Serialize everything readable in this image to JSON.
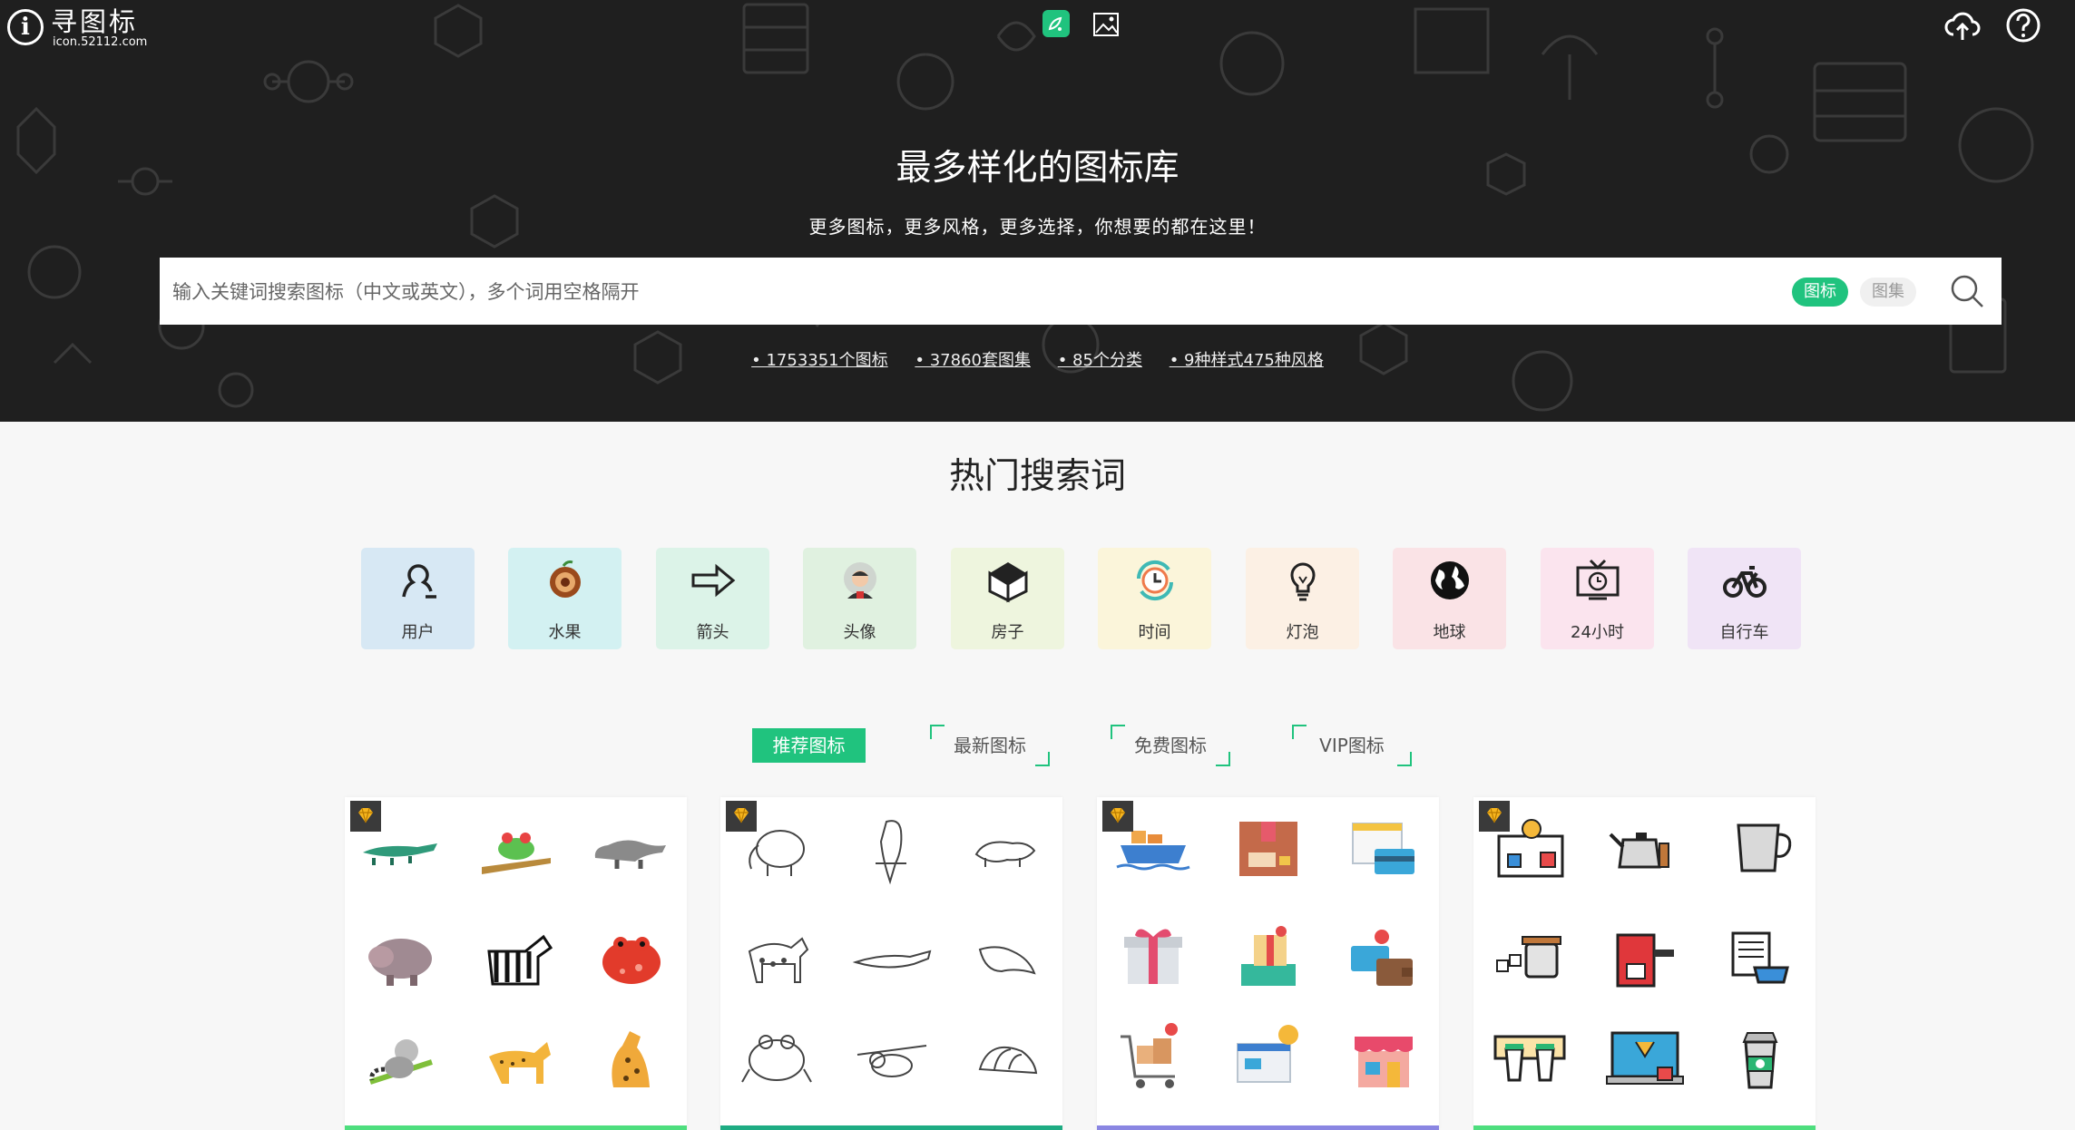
{
  "logo": {
    "name": "寻图标",
    "domain": "icon.52112.com",
    "mark": "i"
  },
  "header": {
    "icons": [
      "illustration-icon",
      "image-icon",
      "upload-icon",
      "help-icon"
    ]
  },
  "hero": {
    "title": "最多样化的图标库",
    "subtitle": "更多图标，更多风格，更多选择，你想要的都在这里！"
  },
  "search": {
    "placeholder": "输入关键词搜索图标（中文或英文），多个词用空格隔开",
    "value": "",
    "scope_icons": "图标",
    "scope_sets": "图集",
    "submit_icon": "search-icon"
  },
  "stats": [
    "• 1753351个图标",
    "• 37860套图集",
    "• 85个分类",
    "• 9种样式475种风格"
  ],
  "hot_section": {
    "title": "热门搜索词",
    "items": [
      {
        "label": "用户",
        "bg": "#d7e8f4",
        "icon": "user-icon"
      },
      {
        "label": "水果",
        "bg": "#d3f1f2",
        "icon": "fruit-icon"
      },
      {
        "label": "箭头",
        "bg": "#dcf3e8",
        "icon": "arrow-icon"
      },
      {
        "label": "头像",
        "bg": "#e0f1e0",
        "icon": "avatar-icon"
      },
      {
        "label": "房子",
        "bg": "#eef5de",
        "icon": "house-icon"
      },
      {
        "label": "时间",
        "bg": "#fbf5da",
        "icon": "clock-icon"
      },
      {
        "label": "灯泡",
        "bg": "#fcf0e4",
        "icon": "light-bulb-icon"
      },
      {
        "label": "地球",
        "bg": "#fae3e6",
        "icon": "globe-icon"
      },
      {
        "label": "24小时",
        "bg": "#fbe4ee",
        "icon": "tv-24h-icon"
      },
      {
        "label": "自行车",
        "bg": "#f0e4f6",
        "icon": "bicycle-icon"
      }
    ]
  },
  "tabs": [
    "推荐图标",
    "最新图标",
    "免费图标",
    "VIP图标"
  ],
  "active_tab": "推荐图标",
  "colors": {
    "accent": "#20c37e",
    "hero_bg": "#1f1f1f"
  },
  "cards": [
    {
      "theme": "animals-flat",
      "bar": "#4ede7e",
      "icons": [
        "crocodile-icon",
        "frog-icon",
        "anteater-icon",
        "hippo-icon",
        "zebra-icon",
        "red-frog-icon",
        "lemur-icon",
        "cheetah-icon",
        "leopard-icon"
      ]
    },
    {
      "theme": "animals-outline",
      "bar": "#1eac83",
      "icons": [
        "elephant-icon",
        "parrot-icon",
        "tapir-icon",
        "hyena-icon",
        "alligator-icon",
        "weasel-icon",
        "toad-icon",
        "sloth-icon",
        "armadillo-icon"
      ]
    },
    {
      "theme": "shopping",
      "bar": "#8a86e2",
      "icons": [
        "cargo-ship-icon",
        "package-box-icon",
        "card-payment-icon",
        "gift-box-icon",
        "gift-coupon-icon",
        "wallet-icon",
        "shopping-cart-icon",
        "browser-payment-icon",
        "store-icon"
      ]
    },
    {
      "theme": "coffee",
      "bar": "#4ede7e",
      "icons": [
        "coffee-menu-icon",
        "kettle-icon",
        "milk-jug-icon",
        "sugar-jar-icon",
        "espresso-machine-icon",
        "newspaper-coffee-icon",
        "takeaway-cups-icon",
        "coffee-laptop-icon",
        "cold-brew-cup-icon"
      ]
    }
  ]
}
